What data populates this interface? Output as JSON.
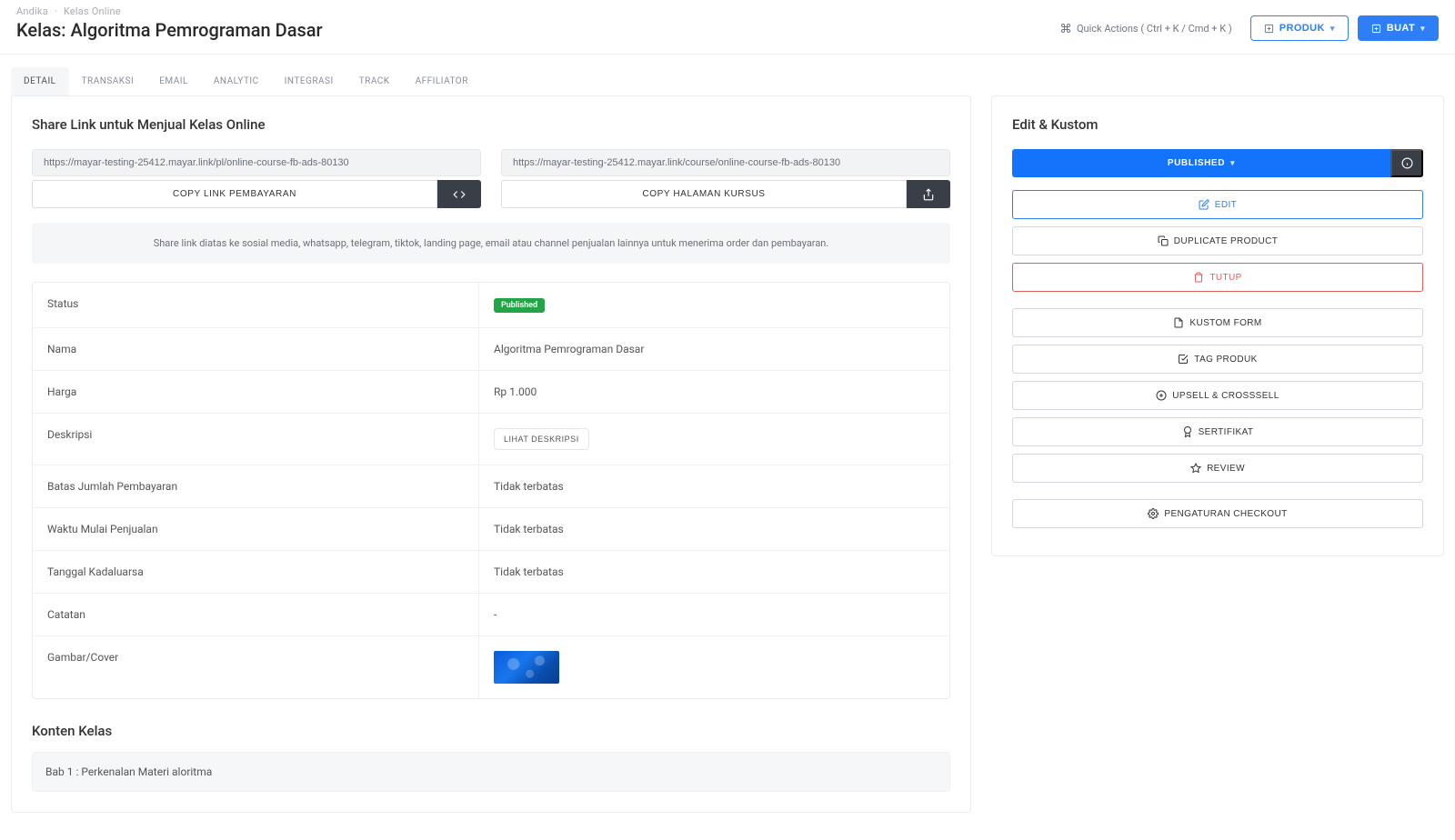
{
  "breadcrumbs": {
    "home": "Andika",
    "section": "Kelas Online"
  },
  "page_title": "Kelas: Algoritma Pemrograman Dasar",
  "header": {
    "quick_actions": "Quick Actions ( Ctrl + K / Cmd + K )",
    "produk": "PRODUK",
    "buat": "BUAT"
  },
  "tabs": [
    {
      "label": "DETAIL",
      "active": true
    },
    {
      "label": "TRANSAKSI"
    },
    {
      "label": "EMAIL"
    },
    {
      "label": "ANALYTIC"
    },
    {
      "label": "INTEGRASI"
    },
    {
      "label": "TRACK"
    },
    {
      "label": "AFFILIATOR"
    }
  ],
  "share": {
    "title": "Share Link untuk Menjual Kelas Online",
    "payment_link": "https://mayar-testing-25412.mayar.link/pl/online-course-fb-ads-80130",
    "course_link": "https://mayar-testing-25412.mayar.link/course/online-course-fb-ads-80130",
    "copy_payment": "COPY LINK PEMBAYARAN",
    "copy_course": "COPY HALAMAN KURSUS",
    "info": "Share link diatas ke sosial media, whatsapp, telegram, tiktok, landing page, email atau channel penjualan lainnya untuk menerima order dan pembayaran."
  },
  "details": {
    "status_k": "Status",
    "status_badge": "Published",
    "nama_k": "Nama",
    "nama_v": "Algoritma Pemrograman Dasar",
    "harga_k": "Harga",
    "harga_v": "Rp 1.000",
    "desk_k": "Deskripsi",
    "desk_btn": "LIHAT DESKRIPSI",
    "batas_k": "Batas Jumlah Pembayaran",
    "batas_v": "Tidak terbatas",
    "mulai_k": "Waktu Mulai Penjualan",
    "mulai_v": "Tidak terbatas",
    "kad_k": "Tanggal Kadaluarsa",
    "kad_v": "Tidak terbatas",
    "cat_k": "Catatan",
    "cat_v": "-",
    "cover_k": "Gambar/Cover"
  },
  "konten": {
    "title": "Konten Kelas",
    "chapter1": "Bab 1 : Perkenalan Materi aloritma"
  },
  "panel": {
    "title": "Edit & Kustom",
    "published": "PUBLISHED",
    "edit": "EDIT",
    "duplicate": "DUPLICATE PRODUCT",
    "tutup": "TUTUP",
    "kustom_form": "KUSTOM FORM",
    "tag_produk": "TAG PRODUK",
    "upsell": "UPSELL & CROSSSELL",
    "sertifikat": "SERTIFIKAT",
    "review": "REVIEW",
    "checkout": "PENGATURAN CHECKOUT"
  }
}
